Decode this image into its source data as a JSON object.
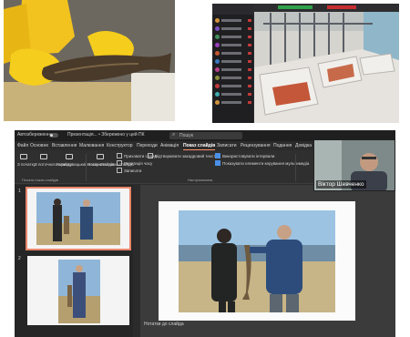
{
  "ppt": {
    "autosave_label": "Автозбереження",
    "doc_title": "Презентація... • Збережено у цей ПК",
    "search_placeholder": "Пошук",
    "tabs": [
      "Файл",
      "Основне",
      "Вставлення",
      "Малювання",
      "Конструктор",
      "Переходи",
      "Анімація",
      "Показ слайдів",
      "Записати",
      "Рецензування",
      "Подання",
      "Довідка"
    ],
    "active_tab": "Показ слайдів",
    "ribbon": {
      "from_start": "З початку",
      "from_current": "З поточного слайда",
      "custom_show": "Користувацький показ слайдів",
      "setup_show": "Настроїти показ слайдів",
      "hide_slide": "Приховати слайд",
      "rehearse": "Репетиція часу",
      "record": "Записати",
      "play_narrations": "Відтворювати закадровий текст",
      "use_timings": "Використовувати інтервали",
      "show_media_controls": "Показувати елементи керування мультимедіа",
      "always_subtitles": "Завжди",
      "monitor": "Монітор",
      "use_presenter_view": "Використовувати режим доповідача",
      "group_start": "Почати показ слайдів",
      "group_setup": "Настроювання",
      "group_monitors": "Монітори"
    },
    "slide_numbers": [
      "1",
      "2"
    ],
    "notes_placeholder": "Нотатки до слайда",
    "webcam_name": "Віктор Шевченко"
  },
  "colors": {
    "accent": "#e8856a",
    "ribbon_bg": "#2f2f2f",
    "app_bg": "#2b2b2b"
  }
}
